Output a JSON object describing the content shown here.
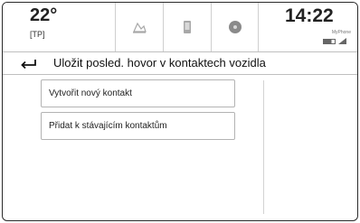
{
  "status": {
    "temperature": "22°",
    "traffic_label": "[TP]",
    "time": "14:22",
    "operator": "MyPhone"
  },
  "tabs": [
    {
      "icon": "navigation-icon"
    },
    {
      "icon": "phone-icon"
    },
    {
      "icon": "media-icon"
    }
  ],
  "header": {
    "back_icon": "back-arrow-icon",
    "title": "Uložit posled. hovor v kontaktech vozidla"
  },
  "options": [
    {
      "label": "Vytvořit nový kontakt"
    },
    {
      "label": "Přidat k stávajícím kontaktům"
    }
  ]
}
